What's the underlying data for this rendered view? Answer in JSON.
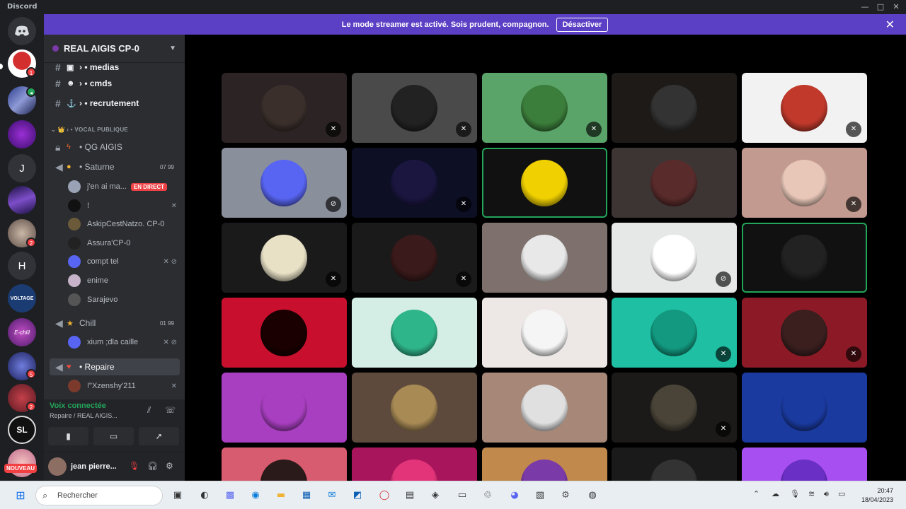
{
  "app": {
    "title": "Discord"
  },
  "banner": {
    "text": "Le mode streamer est activé. Sois prudent, compagnon.",
    "button": "Désactiver"
  },
  "guild": {
    "name": "REAL AIGIS CP-0"
  },
  "servers": {
    "letter_j": "J",
    "letter_h": "H",
    "voltage": "VOLTAGE",
    "echill": "E-chill",
    "sl": "SL",
    "nouveau": "NOUVEAU",
    "badges": [
      "1",
      "2",
      "5",
      "2"
    ]
  },
  "channels": {
    "medias": "medias",
    "cmds": "cmds",
    "recrutement": "recrutement",
    "category": "VOCAL PUBLIQUE",
    "qg": "QG AIGIS",
    "saturne": "Saturne",
    "saturne_count": "07  99",
    "chill": "Chill",
    "chill_count": "01  99",
    "repaire": "Repaire"
  },
  "voice_users": {
    "u1": "j'en ai ma...",
    "live": "EN DIRECT",
    "u2": "!",
    "u3": "AskipCestNatzo. CP-0",
    "u4": "Assura'CP-0",
    "u5": "compt tel",
    "u6": "enime",
    "u7": "Sarajevo",
    "u8": "xium ;dla caille",
    "u9": "!\"Xzenshy'211"
  },
  "voice_panel": {
    "title": "Voix connectée",
    "subtitle": "Repaire / REAL AIGIS..."
  },
  "user": {
    "name": "jean pierre..."
  },
  "taskbar": {
    "search": "Rechercher",
    "time": "20:47",
    "date": "18/04/2023"
  },
  "colors": {
    "banner": "#5b3fc4",
    "speaking": "#23a55a",
    "live": "#ed4245"
  }
}
